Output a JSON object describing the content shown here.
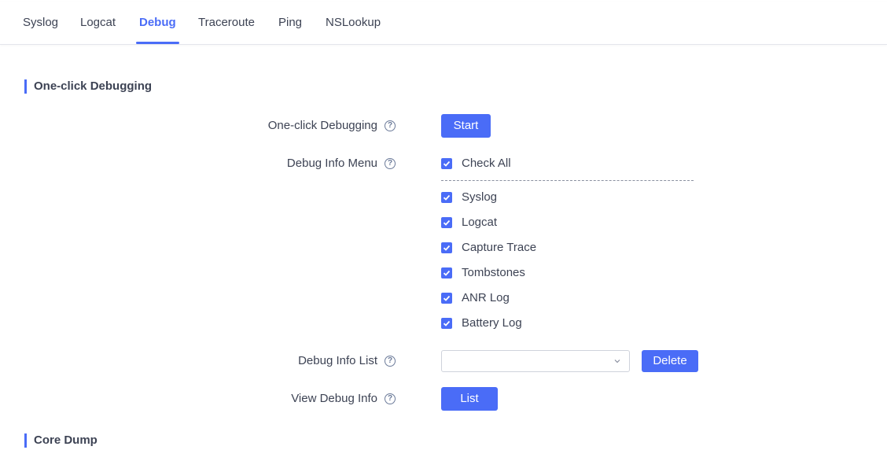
{
  "tabs": [
    {
      "label": "Syslog",
      "active": false
    },
    {
      "label": "Logcat",
      "active": false
    },
    {
      "label": "Debug",
      "active": true
    },
    {
      "label": "Traceroute",
      "active": false
    },
    {
      "label": "Ping",
      "active": false
    },
    {
      "label": "NSLookup",
      "active": false
    }
  ],
  "sections": {
    "one_click": {
      "title": "One-click Debugging"
    },
    "core_dump": {
      "title": "Core Dump"
    }
  },
  "form": {
    "one_click_label": "One-click Debugging",
    "start_button": "Start",
    "debug_menu_label": "Debug Info Menu",
    "check_all": {
      "label": "Check All",
      "checked": true
    },
    "items": [
      {
        "label": "Syslog",
        "checked": true
      },
      {
        "label": "Logcat",
        "checked": true
      },
      {
        "label": "Capture Trace",
        "checked": true
      },
      {
        "label": "Tombstones",
        "checked": true
      },
      {
        "label": "ANR Log",
        "checked": true
      },
      {
        "label": "Battery Log",
        "checked": true
      }
    ],
    "debug_list_label": "Debug Info List",
    "debug_list_value": "",
    "delete_button": "Delete",
    "view_debug_label": "View Debug Info",
    "list_button": "List",
    "help_glyph": "?"
  },
  "colors": {
    "accent": "#4a6cf7",
    "text": "#3d4354",
    "border": "#cfd3dc"
  },
  "icons": {
    "help": "question-circle-icon",
    "check": "check-icon",
    "dropdown": "chevron-down-icon"
  }
}
